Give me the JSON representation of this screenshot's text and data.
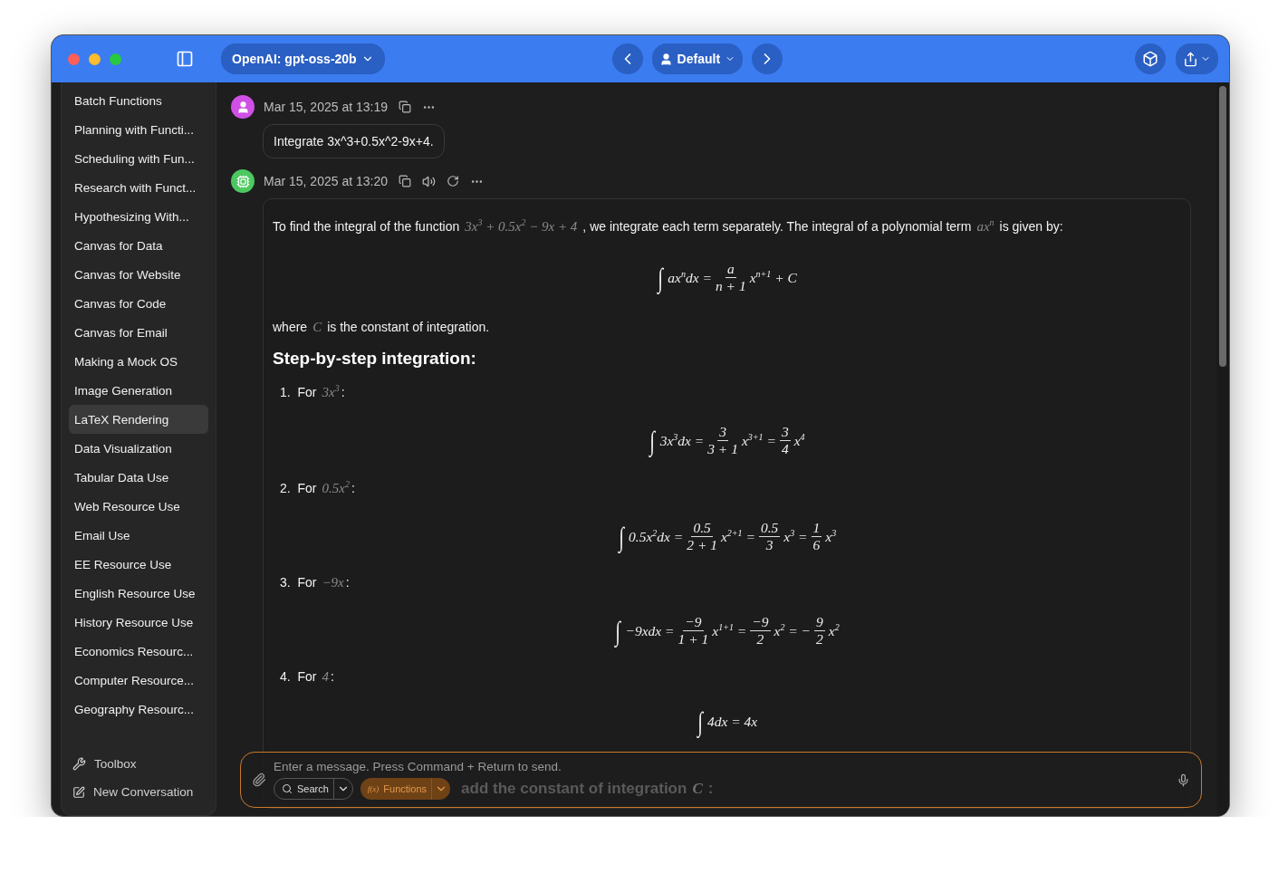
{
  "toolbar": {
    "model": "OpenAI: gpt-oss-20b",
    "profile": "Default"
  },
  "sidebar": {
    "items": [
      {
        "label": "Batch Functions",
        "selected": false
      },
      {
        "label": "Planning with Functi...",
        "selected": false
      },
      {
        "label": "Scheduling with Fun...",
        "selected": false
      },
      {
        "label": "Research with Funct...",
        "selected": false
      },
      {
        "label": "Hypothesizing With...",
        "selected": false
      },
      {
        "label": "Canvas for Data",
        "selected": false
      },
      {
        "label": "Canvas for Website",
        "selected": false
      },
      {
        "label": "Canvas for Code",
        "selected": false
      },
      {
        "label": "Canvas for Email",
        "selected": false
      },
      {
        "label": "Making a Mock OS",
        "selected": false
      },
      {
        "label": "Image Generation",
        "selected": false
      },
      {
        "label": "LaTeX Rendering",
        "selected": true
      },
      {
        "label": "Data Visualization",
        "selected": false
      },
      {
        "label": "Tabular Data Use",
        "selected": false
      },
      {
        "label": "Web Resource Use",
        "selected": false
      },
      {
        "label": "Email Use",
        "selected": false
      },
      {
        "label": "EE Resource Use",
        "selected": false
      },
      {
        "label": "English Resource Use",
        "selected": false
      },
      {
        "label": "History Resource Use",
        "selected": false
      },
      {
        "label": "Economics Resourc...",
        "selected": false
      },
      {
        "label": "Computer Resource...",
        "selected": false
      },
      {
        "label": "Geography Resourc...",
        "selected": false
      }
    ],
    "footer": [
      {
        "kind": "toolbox",
        "label": "Toolbox"
      },
      {
        "kind": "new",
        "label": "New Conversation"
      }
    ]
  },
  "messages": [
    {
      "kind": "user",
      "time": "Mar 15, 2025 at 13:19",
      "text": "Integrate 3x^3+0.5x^2-9x+4."
    },
    {
      "kind": "assistant",
      "time": "Mar 15, 2025 at 13:20",
      "blocks": [
        {
          "kind": "paragraph",
          "pieces": [
            {
              "kind": "text",
              "text": "To find the integral of the function"
            },
            {
              "kind": "math",
              "text": "3x$^{3}$ + 0.5x$^{2}$ − 9x + 4"
            },
            {
              "kind": "text",
              "text": ", we integrate each term separately. The integral of a polynomial term"
            },
            {
              "kind": "math",
              "text": "ax$^{n}$"
            },
            {
              "kind": "text",
              "text": "is given by:"
            }
          ]
        },
        {
          "kind": "equation",
          "tokens": [
            {
              "kind": "int",
              "text": "∫"
            },
            {
              "kind": "m",
              "text": "ax$^{n}$dx ="
            },
            {
              "kind": "frac",
              "num": "a",
              "den": "n + 1"
            },
            {
              "kind": "m",
              "text": "x$^{n+1}$ + C"
            }
          ]
        },
        {
          "kind": "paragraph",
          "pieces": [
            {
              "kind": "text",
              "text": "where"
            },
            {
              "kind": "math",
              "text": "C"
            },
            {
              "kind": "text",
              "text": "is the constant of integration."
            }
          ]
        },
        {
          "kind": "heading",
          "text": "Step-by-step integration:"
        },
        {
          "kind": "step",
          "number": "1.",
          "label": "For",
          "math": "3x$^{3}$",
          "suffix": ":"
        },
        {
          "kind": "equation",
          "tokens": [
            {
              "kind": "int",
              "text": "∫"
            },
            {
              "kind": "m",
              "text": "3x$^{3}$dx ="
            },
            {
              "kind": "frac",
              "num": "3",
              "den": "3 + 1"
            },
            {
              "kind": "m",
              "text": "x$^{3+1}$ ="
            },
            {
              "kind": "frac",
              "num": "3",
              "den": "4"
            },
            {
              "kind": "m",
              "text": "x$^{4}$"
            }
          ]
        },
        {
          "kind": "step",
          "number": "2.",
          "label": "For",
          "math": "0.5x$^{2}$",
          "suffix": ":"
        },
        {
          "kind": "equation",
          "tokens": [
            {
              "kind": "int",
              "text": "∫"
            },
            {
              "kind": "m",
              "text": "0.5x$^{2}$dx ="
            },
            {
              "kind": "frac",
              "num": "0.5",
              "den": "2 + 1"
            },
            {
              "kind": "m",
              "text": "x$^{2+1}$ ="
            },
            {
              "kind": "frac",
              "num": "0.5",
              "den": "3"
            },
            {
              "kind": "m",
              "text": "x$^{3}$ ="
            },
            {
              "kind": "frac",
              "num": "1",
              "den": "6"
            },
            {
              "kind": "m",
              "text": "x$^{3}$"
            }
          ]
        },
        {
          "kind": "step",
          "number": "3.",
          "label": "For",
          "math": "−9x",
          "suffix": ":"
        },
        {
          "kind": "equation",
          "tokens": [
            {
              "kind": "int",
              "text": "∫"
            },
            {
              "kind": "m",
              "text": "−9xdx ="
            },
            {
              "kind": "frac",
              "num": "−9",
              "den": "1 + 1"
            },
            {
              "kind": "m",
              "text": "x$^{1+1}$ ="
            },
            {
              "kind": "frac",
              "num": "−9",
              "den": "2"
            },
            {
              "kind": "m",
              "text": "x$^{2}$ = −"
            },
            {
              "kind": "frac",
              "num": "9",
              "den": "2"
            },
            {
              "kind": "m",
              "text": "x$^{2}$"
            }
          ]
        },
        {
          "kind": "step",
          "number": "4.",
          "label": "For",
          "math": "4",
          "suffix": ":"
        },
        {
          "kind": "equation",
          "tokens": [
            {
              "kind": "int",
              "text": "∫"
            },
            {
              "kind": "m",
              "text": "4dx = 4x"
            }
          ]
        }
      ]
    }
  ],
  "composer": {
    "placeholder": "Enter a message. Press Command + Return to send.",
    "search": "Search",
    "functions_icon": "f(x)",
    "functions": "Functions",
    "behind_text": "add the constant of integration",
    "behind_math": "C",
    "behind_suffix": ":"
  }
}
